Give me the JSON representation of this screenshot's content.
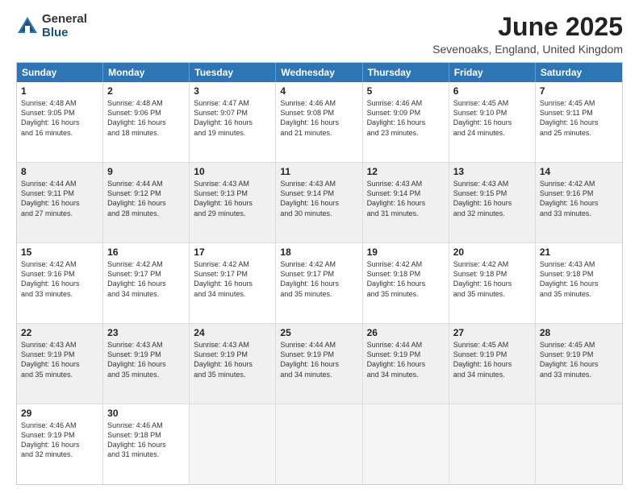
{
  "header": {
    "logo_line1": "General",
    "logo_line2": "Blue",
    "month": "June 2025",
    "location": "Sevenoaks, England, United Kingdom"
  },
  "weekdays": [
    "Sunday",
    "Monday",
    "Tuesday",
    "Wednesday",
    "Thursday",
    "Friday",
    "Saturday"
  ],
  "weeks": [
    [
      {
        "day": "1",
        "lines": [
          "Sunrise: 4:48 AM",
          "Sunset: 9:05 PM",
          "Daylight: 16 hours",
          "and 16 minutes."
        ],
        "shaded": false
      },
      {
        "day": "2",
        "lines": [
          "Sunrise: 4:48 AM",
          "Sunset: 9:06 PM",
          "Daylight: 16 hours",
          "and 18 minutes."
        ],
        "shaded": false
      },
      {
        "day": "3",
        "lines": [
          "Sunrise: 4:47 AM",
          "Sunset: 9:07 PM",
          "Daylight: 16 hours",
          "and 19 minutes."
        ],
        "shaded": false
      },
      {
        "day": "4",
        "lines": [
          "Sunrise: 4:46 AM",
          "Sunset: 9:08 PM",
          "Daylight: 16 hours",
          "and 21 minutes."
        ],
        "shaded": false
      },
      {
        "day": "5",
        "lines": [
          "Sunrise: 4:46 AM",
          "Sunset: 9:09 PM",
          "Daylight: 16 hours",
          "and 23 minutes."
        ],
        "shaded": false
      },
      {
        "day": "6",
        "lines": [
          "Sunrise: 4:45 AM",
          "Sunset: 9:10 PM",
          "Daylight: 16 hours",
          "and 24 minutes."
        ],
        "shaded": false
      },
      {
        "day": "7",
        "lines": [
          "Sunrise: 4:45 AM",
          "Sunset: 9:11 PM",
          "Daylight: 16 hours",
          "and 25 minutes."
        ],
        "shaded": false
      }
    ],
    [
      {
        "day": "8",
        "lines": [
          "Sunrise: 4:44 AM",
          "Sunset: 9:11 PM",
          "Daylight: 16 hours",
          "and 27 minutes."
        ],
        "shaded": true
      },
      {
        "day": "9",
        "lines": [
          "Sunrise: 4:44 AM",
          "Sunset: 9:12 PM",
          "Daylight: 16 hours",
          "and 28 minutes."
        ],
        "shaded": true
      },
      {
        "day": "10",
        "lines": [
          "Sunrise: 4:43 AM",
          "Sunset: 9:13 PM",
          "Daylight: 16 hours",
          "and 29 minutes."
        ],
        "shaded": true
      },
      {
        "day": "11",
        "lines": [
          "Sunrise: 4:43 AM",
          "Sunset: 9:14 PM",
          "Daylight: 16 hours",
          "and 30 minutes."
        ],
        "shaded": true
      },
      {
        "day": "12",
        "lines": [
          "Sunrise: 4:43 AM",
          "Sunset: 9:14 PM",
          "Daylight: 16 hours",
          "and 31 minutes."
        ],
        "shaded": true
      },
      {
        "day": "13",
        "lines": [
          "Sunrise: 4:43 AM",
          "Sunset: 9:15 PM",
          "Daylight: 16 hours",
          "and 32 minutes."
        ],
        "shaded": true
      },
      {
        "day": "14",
        "lines": [
          "Sunrise: 4:42 AM",
          "Sunset: 9:16 PM",
          "Daylight: 16 hours",
          "and 33 minutes."
        ],
        "shaded": true
      }
    ],
    [
      {
        "day": "15",
        "lines": [
          "Sunrise: 4:42 AM",
          "Sunset: 9:16 PM",
          "Daylight: 16 hours",
          "and 33 minutes."
        ],
        "shaded": false
      },
      {
        "day": "16",
        "lines": [
          "Sunrise: 4:42 AM",
          "Sunset: 9:17 PM",
          "Daylight: 16 hours",
          "and 34 minutes."
        ],
        "shaded": false
      },
      {
        "day": "17",
        "lines": [
          "Sunrise: 4:42 AM",
          "Sunset: 9:17 PM",
          "Daylight: 16 hours",
          "and 34 minutes."
        ],
        "shaded": false
      },
      {
        "day": "18",
        "lines": [
          "Sunrise: 4:42 AM",
          "Sunset: 9:17 PM",
          "Daylight: 16 hours",
          "and 35 minutes."
        ],
        "shaded": false
      },
      {
        "day": "19",
        "lines": [
          "Sunrise: 4:42 AM",
          "Sunset: 9:18 PM",
          "Daylight: 16 hours",
          "and 35 minutes."
        ],
        "shaded": false
      },
      {
        "day": "20",
        "lines": [
          "Sunrise: 4:42 AM",
          "Sunset: 9:18 PM",
          "Daylight: 16 hours",
          "and 35 minutes."
        ],
        "shaded": false
      },
      {
        "day": "21",
        "lines": [
          "Sunrise: 4:43 AM",
          "Sunset: 9:18 PM",
          "Daylight: 16 hours",
          "and 35 minutes."
        ],
        "shaded": false
      }
    ],
    [
      {
        "day": "22",
        "lines": [
          "Sunrise: 4:43 AM",
          "Sunset: 9:19 PM",
          "Daylight: 16 hours",
          "and 35 minutes."
        ],
        "shaded": true
      },
      {
        "day": "23",
        "lines": [
          "Sunrise: 4:43 AM",
          "Sunset: 9:19 PM",
          "Daylight: 16 hours",
          "and 35 minutes."
        ],
        "shaded": true
      },
      {
        "day": "24",
        "lines": [
          "Sunrise: 4:43 AM",
          "Sunset: 9:19 PM",
          "Daylight: 16 hours",
          "and 35 minutes."
        ],
        "shaded": true
      },
      {
        "day": "25",
        "lines": [
          "Sunrise: 4:44 AM",
          "Sunset: 9:19 PM",
          "Daylight: 16 hours",
          "and 34 minutes."
        ],
        "shaded": true
      },
      {
        "day": "26",
        "lines": [
          "Sunrise: 4:44 AM",
          "Sunset: 9:19 PM",
          "Daylight: 16 hours",
          "and 34 minutes."
        ],
        "shaded": true
      },
      {
        "day": "27",
        "lines": [
          "Sunrise: 4:45 AM",
          "Sunset: 9:19 PM",
          "Daylight: 16 hours",
          "and 34 minutes."
        ],
        "shaded": true
      },
      {
        "day": "28",
        "lines": [
          "Sunrise: 4:45 AM",
          "Sunset: 9:19 PM",
          "Daylight: 16 hours",
          "and 33 minutes."
        ],
        "shaded": true
      }
    ],
    [
      {
        "day": "29",
        "lines": [
          "Sunrise: 4:46 AM",
          "Sunset: 9:19 PM",
          "Daylight: 16 hours",
          "and 32 minutes."
        ],
        "shaded": false
      },
      {
        "day": "30",
        "lines": [
          "Sunrise: 4:46 AM",
          "Sunset: 9:18 PM",
          "Daylight: 16 hours",
          "and 31 minutes."
        ],
        "shaded": false
      },
      {
        "day": "",
        "lines": [],
        "shaded": true,
        "empty": true
      },
      {
        "day": "",
        "lines": [],
        "shaded": true,
        "empty": true
      },
      {
        "day": "",
        "lines": [],
        "shaded": true,
        "empty": true
      },
      {
        "day": "",
        "lines": [],
        "shaded": true,
        "empty": true
      },
      {
        "day": "",
        "lines": [],
        "shaded": true,
        "empty": true
      }
    ]
  ]
}
